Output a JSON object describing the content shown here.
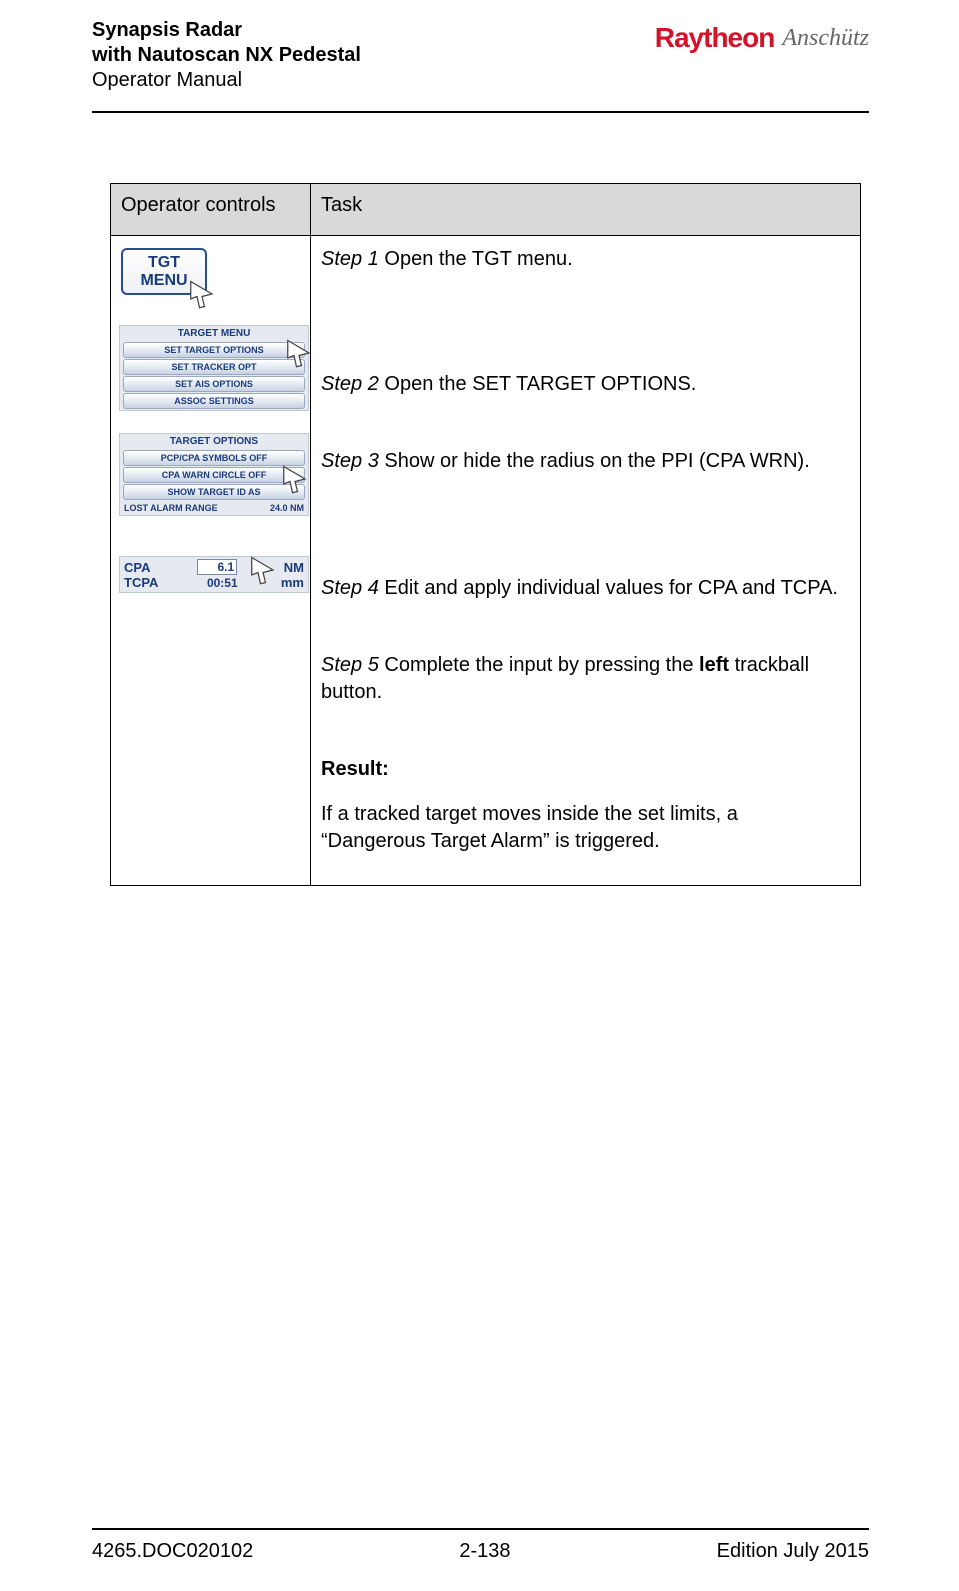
{
  "header": {
    "title_line1": "Synapsis Radar",
    "title_line2": "with Nautoscan NX Pedestal",
    "title_line3": "Operator Manual",
    "logo1": "Raytheon",
    "logo2": "Anschütz"
  },
  "table": {
    "col1_header": "Operator controls",
    "col2_header": "Task"
  },
  "controls": {
    "tgt_btn_line1": "TGT",
    "tgt_btn_line2": "MENU",
    "menu1": {
      "title": "TARGET MENU",
      "b1": "SET TARGET OPTIONS",
      "b2": "SET TRACKER OPT",
      "b3": "SET AIS OPTIONS",
      "b4": "ASSOC SETTINGS"
    },
    "menu2": {
      "title": "TARGET OPTIONS",
      "b1": "PCP/CPA SYMBOLS OFF",
      "b2": "CPA WARN CIRCLE OFF",
      "b3": "SHOW TARGET ID AS",
      "row_label": "LOST ALARM RANGE",
      "row_val": "24.0  NM"
    },
    "cpa": {
      "cpa_label": "CPA",
      "cpa_val": "6.1",
      "cpa_unit": "NM",
      "tcpa_label": "TCPA",
      "tcpa_val": "00:51",
      "tcpa_unit": "mm"
    }
  },
  "task": {
    "s1_label": "Step 1",
    "s1_text": " Open the TGT menu.",
    "s2_label": "Step 2",
    "s2_text": " Open the SET TARGET OPTIONS.",
    "s3_label": "Step 3",
    "s3_text": " Show or hide the radius on the PPI (CPA WRN).",
    "s4_label": "Step 4",
    "s4_text": " Edit and apply individual values for CPA and TCPA.",
    "s5_label": "Step 5",
    "s5_text_a": " Complete the input by pressing the ",
    "s5_bold": "left",
    "s5_text_b": " trackball button.",
    "result_label": "Result:",
    "result_text": "If a tracked target moves inside the set limits, a “Dangerous Target Alarm” is triggered."
  },
  "footer": {
    "left": "4265.DOC020102",
    "center": "2-138",
    "right": "Edition July 2015"
  }
}
